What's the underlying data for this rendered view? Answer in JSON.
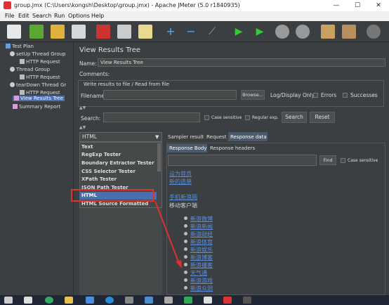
{
  "window": {
    "title": "group.jmx (C:\\Users\\kongsh\\Desktop\\group.jmx) - Apache JMeter (5.0 r1840935)",
    "min": "—",
    "max": "☐",
    "close": "✕"
  },
  "menu": [
    "File",
    "Edit",
    "Search",
    "Run",
    "Options",
    "Help"
  ],
  "tree": [
    {
      "label": "Test Plan",
      "icon": "test-plan-icon"
    },
    {
      "label": "setUp Thread Group",
      "icon": "thread-group-icon"
    },
    {
      "label": "HTTP Request",
      "icon": "http-request-icon"
    },
    {
      "label": "Thread Group",
      "icon": "thread-group-icon"
    },
    {
      "label": "HTTP Request",
      "icon": "http-request-icon"
    },
    {
      "label": "tearDown Thread Gr",
      "icon": "thread-group-icon"
    },
    {
      "label": "HTTP Request",
      "icon": "http-request-icon"
    },
    {
      "label": "View Results Tree",
      "icon": "listener-icon"
    },
    {
      "label": "Summary Report",
      "icon": "listener-icon"
    }
  ],
  "panel": {
    "heading": "View Results Tree",
    "name_label": "Name:",
    "name_value": "View Results Tree",
    "comments_label": "Comments:",
    "file_section": "Write results to file / Read from file",
    "filename_label": "Filename",
    "browse": "Browse...",
    "log_display": "Log/Display Only:",
    "errors": "Errors",
    "successes": "Successes",
    "search_label": "Search:",
    "case_sensitive": "Case sensitive",
    "regex": "Regular exp.",
    "search_btn": "Search",
    "reset_btn": "Reset"
  },
  "renderer": {
    "selected": "HTML",
    "options": [
      "Text",
      "RegExp Tester",
      "Boundary Extractor Tester",
      "CSS Selector Tester",
      "XPath Tester",
      "JSON Path Tester",
      "HTML",
      "HTML Source Formatted"
    ]
  },
  "tabs": [
    "Sampler result",
    "Request",
    "Response data"
  ],
  "subtabs": [
    "Response Body",
    "Response headers"
  ],
  "find": {
    "button": "Find",
    "case": "Case sensitive"
  },
  "response": {
    "links_top": [
      "设为首页",
      "新的选单"
    ],
    "link3": "手机新浪网",
    "text1": "移动客户端",
    "items": [
      "新浪微博",
      "新浪新闻",
      "新浪财经",
      "新浪体育",
      "新浪娱乐",
      "新浪博客",
      "新浪播客",
      "天气通",
      "新浪游戏",
      "新浪众测"
    ]
  }
}
